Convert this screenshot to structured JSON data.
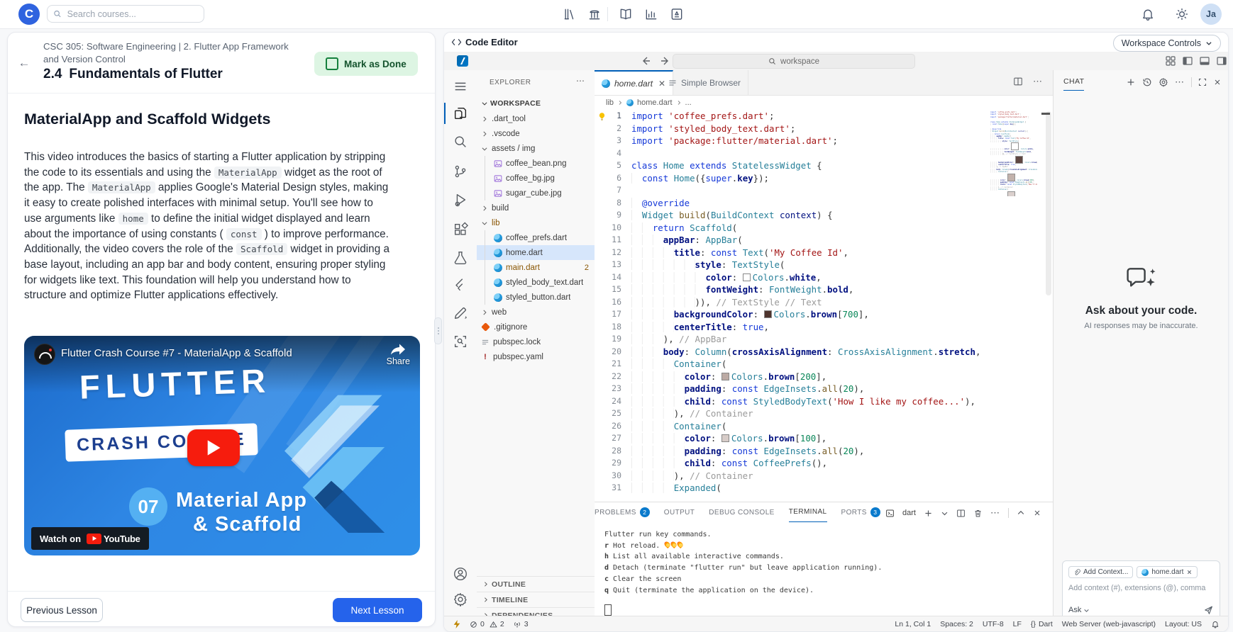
{
  "navbar": {
    "search_placeholder": "Search courses...",
    "avatar_initials": "Ja"
  },
  "lesson": {
    "breadcrumb": "CSC 305: Software Engineering | 2. Flutter App Framework and Version Control",
    "title_number": "2.4",
    "title": "Fundamentals of Flutter",
    "mark_as_done": "Mark as Done",
    "heading": "MaterialApp and Scaffold Widgets",
    "paragraph": [
      {
        "t": "This video introduces the basics of starting a Flutter application by stripping the code to its essentials and using the "
      },
      {
        "c": "MaterialApp"
      },
      {
        "t": " widget as the root of the app. The "
      },
      {
        "c": "MaterialApp"
      },
      {
        "t": " applies Google's Material Design styles, making it easy to create polished interfaces with minimal setup. You'll see how to use arguments like "
      },
      {
        "c": "home"
      },
      {
        "t": " to define the initial widget displayed and learn about the importance of using constants ( "
      },
      {
        "c": "const"
      },
      {
        "t": " ) to improve performance. Additionally, the video covers the role of the "
      },
      {
        "c": "Scaffold"
      },
      {
        "t": " widget in providing a base layout, including an app bar and body content, ensuring proper styling for widgets like text. This foundation will help you understand how to structure and optimize Flutter applications effectively."
      }
    ],
    "video": {
      "title": "Flutter Crash Course #7 - MaterialApp & Scaffold",
      "share": "Share",
      "headline": "FLUTTER",
      "subhead": "CRASH COURSE",
      "episode": "07",
      "caption_line1": "Material App",
      "caption_line2": "& Scaffold",
      "watch_on": "Watch on",
      "provider": "YouTube"
    },
    "previous_button": "Previous Lesson",
    "next_button": "Next Lesson"
  },
  "editor_panel": {
    "title": "Code Editor",
    "workspace_controls": "Workspace Controls"
  },
  "vscode": {
    "titlebar": {
      "search_value": "workspace"
    },
    "explorer": {
      "header": "EXPLORER",
      "root": "WORKSPACE",
      "tree": [
        {
          "l": ".dart_tool",
          "ch": "r",
          "d": 1
        },
        {
          "l": ".vscode",
          "ch": "r",
          "d": 1
        },
        {
          "l": "assets / img",
          "ch": "d",
          "d": 1
        },
        {
          "l": "coffee_bean.png",
          "ic": "img",
          "d": 2,
          "g": 1
        },
        {
          "l": "coffee_bg.jpg",
          "ic": "img",
          "d": 2,
          "g": 1
        },
        {
          "l": "sugar_cube.jpg",
          "ic": "img",
          "d": 2,
          "g": 1
        },
        {
          "l": "build",
          "ch": "r",
          "d": 1
        },
        {
          "l": "lib",
          "ch": "d",
          "d": 1,
          "cls": "mod"
        },
        {
          "l": "coffee_prefs.dart",
          "ic": "dart",
          "d": 2,
          "g": 2
        },
        {
          "l": "home.dart",
          "ic": "dart",
          "d": 2,
          "sel": true,
          "g": 2
        },
        {
          "l": "main.dart",
          "ic": "dart",
          "d": 2,
          "cls": "warn",
          "badge": "2",
          "g": 2
        },
        {
          "l": "styled_body_text.dart",
          "ic": "dart",
          "d": 2,
          "g": 2
        },
        {
          "l": "styled_button.dart",
          "ic": "dart",
          "d": 2,
          "g": 2
        },
        {
          "l": "web",
          "ch": "r",
          "d": 1
        },
        {
          "l": ".gitignore",
          "ic": "git",
          "d": 1
        },
        {
          "l": "pubspec.lock",
          "ic": "lock",
          "d": 1
        },
        {
          "l": "pubspec.yaml",
          "ic": "yaml",
          "d": 1
        }
      ],
      "sections": [
        "OUTLINE",
        "TIMELINE",
        "DEPENDENCIES"
      ]
    },
    "tabs": {
      "active": "home.dart",
      "secondary": "Simple Browser"
    },
    "breadcrumb": [
      "lib",
      "home.dart",
      "..."
    ],
    "code_lines": [
      [
        [
          "k",
          "import"
        ],
        [
          "d",
          " "
        ],
        [
          "s",
          "'coffee_prefs.dart'"
        ],
        [
          "d",
          ";"
        ]
      ],
      [
        [
          "k",
          "import"
        ],
        [
          "d",
          " "
        ],
        [
          "s",
          "'styled_body_text.dart'"
        ],
        [
          "d",
          ";"
        ]
      ],
      [
        [
          "k",
          "import"
        ],
        [
          "d",
          " "
        ],
        [
          "s",
          "'package:flutter/material.dart'"
        ],
        [
          "d",
          ";"
        ]
      ],
      [],
      [
        [
          "k",
          "class"
        ],
        [
          "d",
          " "
        ],
        [
          "t",
          "Home"
        ],
        [
          "d",
          " "
        ],
        [
          "k",
          "extends"
        ],
        [
          "d",
          " "
        ],
        [
          "t",
          "StatelessWidget"
        ],
        [
          "d",
          " {"
        ]
      ],
      [
        [
          "d",
          "  "
        ],
        [
          "k",
          "const"
        ],
        [
          "d",
          " "
        ],
        [
          "t",
          "Home"
        ],
        [
          "d",
          "({"
        ],
        [
          "k",
          "super"
        ],
        [
          "d",
          "."
        ],
        [
          "p",
          "key"
        ],
        [
          "d",
          "});"
        ]
      ],
      [],
      [
        [
          "d",
          "  "
        ],
        [
          "k",
          "@override"
        ]
      ],
      [
        [
          "d",
          "  "
        ],
        [
          "t",
          "Widget"
        ],
        [
          "d",
          " "
        ],
        [
          "f",
          "build"
        ],
        [
          "d",
          "("
        ],
        [
          "t",
          "BuildContext"
        ],
        [
          "d",
          " "
        ],
        [
          "v",
          "context"
        ],
        [
          "d",
          ") {"
        ]
      ],
      [
        [
          "d",
          "    "
        ],
        [
          "k",
          "return"
        ],
        [
          "d",
          " "
        ],
        [
          "t",
          "Scaffold"
        ],
        [
          "d",
          "("
        ]
      ],
      [
        [
          "d",
          "      "
        ],
        [
          "p",
          "appBar"
        ],
        [
          "d",
          ": "
        ],
        [
          "t",
          "AppBar"
        ],
        [
          "d",
          "("
        ]
      ],
      [
        [
          "d",
          "        "
        ],
        [
          "p",
          "title"
        ],
        [
          "d",
          ": "
        ],
        [
          "k",
          "const"
        ],
        [
          "d",
          " "
        ],
        [
          "t",
          "Text"
        ],
        [
          "d",
          "("
        ],
        [
          "s",
          "'My Coffee Id'"
        ],
        [
          "d",
          ","
        ]
      ],
      [
        [
          "d",
          "            "
        ],
        [
          "p",
          "style"
        ],
        [
          "d",
          ": "
        ],
        [
          "t",
          "TextStyle"
        ],
        [
          "d",
          "("
        ]
      ],
      [
        [
          "d",
          "              "
        ],
        [
          "p",
          "color"
        ],
        [
          "d",
          ": "
        ],
        [
          "sw",
          "#ffffff"
        ],
        [
          "t",
          "Colors"
        ],
        [
          "d",
          "."
        ],
        [
          "p",
          "white"
        ],
        [
          "d",
          ","
        ]
      ],
      [
        [
          "d",
          "              "
        ],
        [
          "p",
          "fontWeight"
        ],
        [
          "d",
          ": "
        ],
        [
          "t",
          "FontWeight"
        ],
        [
          "d",
          "."
        ],
        [
          "p",
          "bold"
        ],
        [
          "d",
          ","
        ]
      ],
      [
        [
          "d",
          "            )), "
        ],
        [
          "c",
          "// TextStyle // Text"
        ]
      ],
      [
        [
          "d",
          "        "
        ],
        [
          "p",
          "backgroundColor"
        ],
        [
          "d",
          ": "
        ],
        [
          "sw",
          "#4e342e"
        ],
        [
          "t",
          "Colors"
        ],
        [
          "d",
          "."
        ],
        [
          "p",
          "brown"
        ],
        [
          "d",
          "["
        ],
        [
          "n",
          "700"
        ],
        [
          "d",
          "],"
        ]
      ],
      [
        [
          "d",
          "        "
        ],
        [
          "p",
          "centerTitle"
        ],
        [
          "d",
          ": "
        ],
        [
          "k",
          "true"
        ],
        [
          "d",
          ","
        ]
      ],
      [
        [
          "d",
          "      ), "
        ],
        [
          "c",
          "// AppBar"
        ]
      ],
      [
        [
          "d",
          "      "
        ],
        [
          "p",
          "body"
        ],
        [
          "d",
          ": "
        ],
        [
          "t",
          "Column"
        ],
        [
          "d",
          "("
        ],
        [
          "p",
          "crossAxisAlignment"
        ],
        [
          "d",
          ": "
        ],
        [
          "t",
          "CrossAxisAlignment"
        ],
        [
          "d",
          "."
        ],
        [
          "p",
          "stretch"
        ],
        [
          "d",
          ","
        ]
      ],
      [
        [
          "d",
          "        "
        ],
        [
          "t",
          "Container"
        ],
        [
          "d",
          "("
        ]
      ],
      [
        [
          "d",
          "          "
        ],
        [
          "p",
          "color"
        ],
        [
          "d",
          ": "
        ],
        [
          "sw",
          "#bcaaa4"
        ],
        [
          "t",
          "Colors"
        ],
        [
          "d",
          "."
        ],
        [
          "p",
          "brown"
        ],
        [
          "d",
          "["
        ],
        [
          "n",
          "200"
        ],
        [
          "d",
          "],"
        ]
      ],
      [
        [
          "d",
          "          "
        ],
        [
          "p",
          "padding"
        ],
        [
          "d",
          ": "
        ],
        [
          "k",
          "const"
        ],
        [
          "d",
          " "
        ],
        [
          "t",
          "EdgeInsets"
        ],
        [
          "d",
          "."
        ],
        [
          "f",
          "all"
        ],
        [
          "d",
          "("
        ],
        [
          "n",
          "20"
        ],
        [
          "d",
          "),"
        ]
      ],
      [
        [
          "d",
          "          "
        ],
        [
          "p",
          "child"
        ],
        [
          "d",
          ": "
        ],
        [
          "k",
          "const"
        ],
        [
          "d",
          " "
        ],
        [
          "t",
          "StyledBodyText"
        ],
        [
          "d",
          "("
        ],
        [
          "s",
          "'How I like my coffee...'"
        ],
        [
          "d",
          "),"
        ]
      ],
      [
        [
          "d",
          "        ), "
        ],
        [
          "c",
          "// Container"
        ]
      ],
      [
        [
          "d",
          "        "
        ],
        [
          "t",
          "Container"
        ],
        [
          "d",
          "("
        ]
      ],
      [
        [
          "d",
          "          "
        ],
        [
          "p",
          "color"
        ],
        [
          "d",
          ": "
        ],
        [
          "sw",
          "#d7ccc8"
        ],
        [
          "t",
          "Colors"
        ],
        [
          "d",
          "."
        ],
        [
          "p",
          "brown"
        ],
        [
          "d",
          "["
        ],
        [
          "n",
          "100"
        ],
        [
          "d",
          "],"
        ]
      ],
      [
        [
          "d",
          "          "
        ],
        [
          "p",
          "padding"
        ],
        [
          "d",
          ": "
        ],
        [
          "k",
          "const"
        ],
        [
          "d",
          " "
        ],
        [
          "t",
          "EdgeInsets"
        ],
        [
          "d",
          "."
        ],
        [
          "f",
          "all"
        ],
        [
          "d",
          "("
        ],
        [
          "n",
          "20"
        ],
        [
          "d",
          "),"
        ]
      ],
      [
        [
          "d",
          "          "
        ],
        [
          "p",
          "child"
        ],
        [
          "d",
          ": "
        ],
        [
          "k",
          "const"
        ],
        [
          "d",
          " "
        ],
        [
          "t",
          "CoffeePrefs"
        ],
        [
          "d",
          "(),"
        ]
      ],
      [
        [
          "d",
          "        ), "
        ],
        [
          "c",
          "// Container"
        ]
      ],
      [
        [
          "d",
          "        "
        ],
        [
          "t",
          "Expanded"
        ],
        [
          "d",
          "("
        ]
      ]
    ],
    "terminal": {
      "tabs": [
        {
          "label": "PROBLEMS",
          "badge": "2"
        },
        {
          "label": "OUTPUT"
        },
        {
          "label": "DEBUG CONSOLE"
        },
        {
          "label": "TERMINAL",
          "active": true
        },
        {
          "label": "PORTS",
          "badge": "3"
        }
      ],
      "shell": "dart",
      "lines": [
        [
          [
            "d",
            "Flutter run key commands."
          ]
        ],
        [
          [
            "b",
            "r"
          ],
          [
            "d",
            " Hot reload. "
          ],
          [
            "fire",
            "3"
          ]
        ],
        [
          [
            "b",
            "h"
          ],
          [
            "d",
            " List all available interactive commands."
          ]
        ],
        [
          [
            "b",
            "d"
          ],
          [
            "d",
            " Detach (terminate \"flutter run\" but leave application running)."
          ]
        ],
        [
          [
            "b",
            "c"
          ],
          [
            "d",
            " Clear the screen"
          ]
        ],
        [
          [
            "b",
            "q"
          ],
          [
            "d",
            " Quit (terminate the application on the device)."
          ]
        ]
      ]
    },
    "chat": {
      "tab": "CHAT",
      "empty_title": "Ask about your code.",
      "empty_subtitle": "AI responses may be inaccurate.",
      "add_context": "Add Context...",
      "context_file": "home.dart",
      "input_placeholder": "Add context (#), extensions (@), comma",
      "mode": "Ask"
    },
    "status": {
      "errors": "0",
      "warnings": "2",
      "ports": "3",
      "line_col": "Ln 1, Col 1",
      "spaces": "Spaces: 2",
      "encoding": "UTF-8",
      "eol": "LF",
      "language": "Dart",
      "braces": "{}",
      "server": "Web Server (web-javascript)",
      "layout": "Layout: US"
    }
  }
}
